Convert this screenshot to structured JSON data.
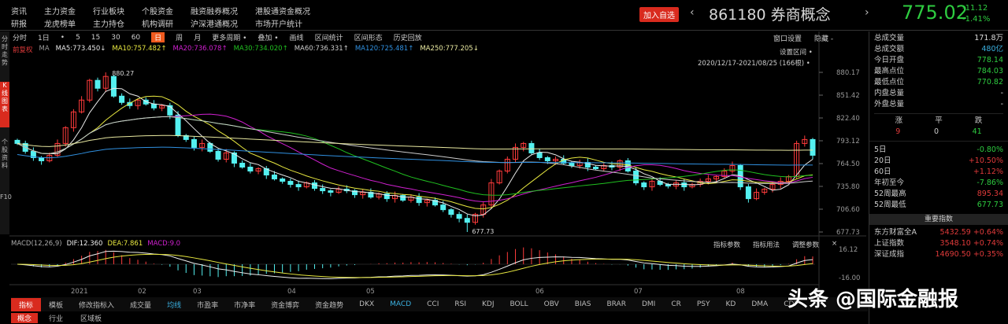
{
  "top_menu": {
    "row1": [
      "资讯",
      "主力资金",
      "行业板块",
      "个股资金",
      "融资融券概况",
      "港股通资金概况"
    ],
    "row2": [
      "研报",
      "龙虎榜单",
      "主力持仓",
      "机构调研",
      "沪深港通概况",
      "市场开户统计"
    ]
  },
  "header": {
    "add_button": "加入自选",
    "code": "861180",
    "name": "券商概念",
    "price": "775.02",
    "change": "-11.12",
    "change_pct": "-1.41%",
    "prev": "‹",
    "next": "›"
  },
  "left_tabs": [
    "分时走势",
    "K线图表",
    "个股资料",
    "F10"
  ],
  "toolbar": {
    "items": [
      "分时",
      "1日",
      "•",
      "5",
      "15",
      "30",
      "60",
      "日",
      "周",
      "月",
      "更多周期 •",
      "叠加 •",
      "画线",
      "区间统计",
      "区间形态",
      "历史回放"
    ],
    "active": "日",
    "right": [
      "窗口设置",
      "隐藏 -"
    ]
  },
  "ma_legend": [
    {
      "t": "前复权",
      "c": "#e03a3a"
    },
    {
      "t": "MA",
      "c": "#999"
    },
    {
      "t": "MA5:773.450↓",
      "c": "#e8e8e8"
    },
    {
      "t": "MA10:757.482↑",
      "c": "#e8e840"
    },
    {
      "t": "MA20:736.078↑",
      "c": "#d020d0"
    },
    {
      "t": "MA30:734.020↑",
      "c": "#20c020"
    },
    {
      "t": "MA60:736.331↑",
      "c": "#cccccc"
    },
    {
      "t": "MA120:725.481↑",
      "c": "#3090e0"
    },
    {
      "t": "MA250:777.205↓",
      "c": "#e8e8a0"
    }
  ],
  "chart_overlay": {
    "setting": "设置区间 •",
    "range": "2020/12/17-2021/08/25 (166根) •",
    "high_label": "880.27",
    "low_label": "677.73"
  },
  "chart_data": {
    "type": "candlestick",
    "ylim": [
      677.73,
      880.17
    ],
    "y_ticks": [
      "880.17",
      "851.42",
      "822.40",
      "793.12",
      "764.50",
      "735.80",
      "706.60",
      "677.73"
    ],
    "closes": [
      790,
      780,
      772,
      768,
      775,
      790,
      810,
      830,
      845,
      870,
      860,
      875,
      850,
      842,
      838,
      845,
      840,
      835,
      838,
      826,
      800,
      795,
      785,
      790,
      780,
      770,
      778,
      765,
      760,
      755,
      758,
      750,
      745,
      742,
      738,
      735,
      740,
      733,
      730,
      728,
      732,
      730,
      725,
      728,
      722,
      726,
      720,
      724,
      718,
      722,
      715,
      718,
      712,
      706,
      700,
      695,
      690,
      700,
      712,
      740,
      755,
      770,
      785,
      790,
      778,
      772,
      768,
      770,
      765,
      762,
      766,
      760,
      758,
      762,
      760,
      768,
      755,
      740,
      735,
      742,
      738,
      736,
      740,
      735,
      738,
      742,
      745,
      748,
      755,
      762,
      735,
      720,
      728,
      732,
      738,
      742,
      748,
      790,
      795,
      775
    ],
    "x_labels": [
      "2021",
      "02",
      "03",
      "04",
      "05",
      "06",
      "07",
      "08"
    ],
    "macd_legend": [
      "MACD(12,26,9)",
      "DIF:12.360",
      "DEA:7.861",
      "MACD:9.0"
    ],
    "macd_ticks": [
      "16.12",
      "-16.00"
    ],
    "macd_buttons": [
      "指标参数",
      "指标用法",
      "调整参数",
      "×"
    ]
  },
  "stats": [
    {
      "k": "总成交量",
      "v": "171.8万",
      "c": "#ddd"
    },
    {
      "k": "总成交额",
      "v": "480亿",
      "c": "#3ab0e0"
    },
    {
      "k": "今日开盘",
      "v": "778.14",
      "c": "#2ecc40"
    },
    {
      "k": "最高点位",
      "v": "784.03",
      "c": "#2ecc40"
    },
    {
      "k": "最低点位",
      "v": "770.82",
      "c": "#2ecc40"
    },
    {
      "k": "内盘总量",
      "v": "-",
      "c": "#ddd"
    },
    {
      "k": "外盘总量",
      "v": "-",
      "c": "#ddd"
    }
  ],
  "breadth": {
    "labels": [
      "涨",
      "平",
      "跌"
    ],
    "values": [
      "9",
      "0",
      "41"
    ]
  },
  "perf": [
    {
      "k": "5日",
      "v": "-0.80%",
      "c": "#2ecc40"
    },
    {
      "k": "20日",
      "v": "+10.50%",
      "c": "#e03a3a"
    },
    {
      "k": "60日",
      "v": "+1.12%",
      "c": "#e03a3a"
    },
    {
      "k": "年初至今",
      "v": "-7.86%",
      "c": "#2ecc40"
    },
    {
      "k": "52周最高",
      "v": "895.34",
      "c": "#e03a3a"
    },
    {
      "k": "52周最低",
      "v": "677.73",
      "c": "#2ecc40"
    }
  ],
  "index_header": "重要指数",
  "indices": [
    {
      "k": "东方财富全A",
      "v": "5432.59 +0.64%"
    },
    {
      "k": "上证指数",
      "v": "3548.10 +0.74%"
    },
    {
      "k": "深证成指",
      "v": "14690.50 +0.35%"
    }
  ],
  "bottom_tabs": [
    "指标",
    "模板",
    "修改指标入",
    "成交量",
    "均线",
    "市盈率",
    "市净率",
    "资金博弈",
    "资金趋势",
    "DKX",
    "MACD",
    "CCI",
    "RSI",
    "KDJ",
    "BOLL",
    "OBV",
    "BIAS",
    "BRAR",
    "DMI",
    "CR",
    "PSY",
    "KD",
    "DMA",
    "CDP"
  ],
  "bottom_row2": [
    "概念",
    "行业",
    "区域板"
  ],
  "watermark": "头条 @国际金融报"
}
